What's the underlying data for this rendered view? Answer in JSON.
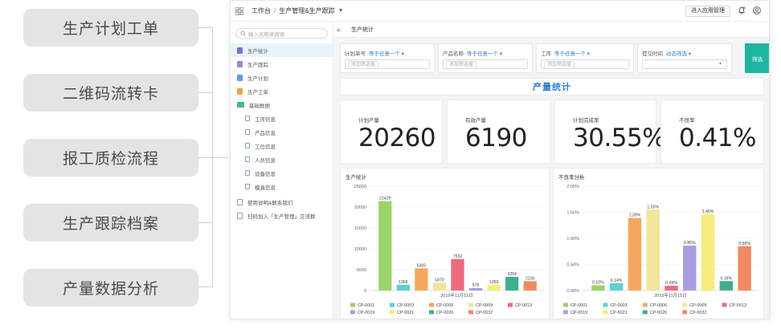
{
  "features": [
    "生产计划工单",
    "二维码流转卡",
    "报工质检流程",
    "生产跟踪档案",
    "产量数据分析"
  ],
  "topbar": {
    "workspace": "工作台",
    "app_name": "生产管理&生产跟踪",
    "enter_button": "进入应用管理"
  },
  "sidebar": {
    "search_placeholder": "输入名称来搜索",
    "items": [
      {
        "label": "生产统计",
        "color": "#7b6cd6",
        "active": true
      },
      {
        "label": "生产跟踪",
        "color": "#9a8ad9",
        "active": false
      },
      {
        "label": "生产计划",
        "color": "#5aa0e0",
        "active": false
      },
      {
        "label": "生产工单",
        "color": "#f0a33c",
        "active": false
      },
      {
        "label": "基础数据",
        "color": "#46b886",
        "active": false
      }
    ],
    "sub_items": [
      "工序信息",
      "产品信息",
      "工位信息",
      "人员信息",
      "设备信息",
      "模具信息"
    ],
    "bottom_items": [
      "使用说明&联系我们",
      "扫码加入「生产管理」交流群"
    ]
  },
  "tab": {
    "label": "生产统计"
  },
  "filters": [
    {
      "label": "计划单号",
      "mode": "等于任意一个",
      "placeholder": "添加筛选值"
    },
    {
      "label": "产品名称",
      "mode": "等于任意一个",
      "placeholder": "添加筛选值"
    },
    {
      "label": "工序",
      "mode": "等于任意一个",
      "placeholder": "添加筛选值"
    },
    {
      "label": "提交时间",
      "mode": "动态筛选",
      "placeholder": ""
    }
  ],
  "filter_button": "筛选",
  "report_title": "产量统计",
  "kpis": [
    {
      "label": "计划产量",
      "value": "20260"
    },
    {
      "label": "有效产量",
      "value": "6190"
    },
    {
      "label": "计划完成率",
      "value": "30.55%"
    },
    {
      "label": "不良率",
      "value": "0.41%"
    }
  ],
  "chart_data": [
    {
      "type": "bar",
      "title": "生产统计",
      "xlabel": "2019年11月15日",
      "ylim": [
        0,
        25000
      ],
      "yticks": [
        "0",
        "5000",
        "10000",
        "15000",
        "20000",
        "25000"
      ],
      "series": [
        {
          "name": "CP-0001",
          "color": "#9bd36b",
          "value": 21429,
          "label": "21429"
        },
        {
          "name": "CP-0003",
          "color": "#5ecfd6",
          "value": 1366,
          "label": "1366"
        },
        {
          "name": "CP-0006",
          "color": "#f2a95e",
          "value": 5305,
          "label": "5305"
        },
        {
          "name": "CP-0009",
          "color": "#f2e49a",
          "value": 1870,
          "label": "1870"
        },
        {
          "name": "CP-0013",
          "color": "#ee6a80",
          "value": 7532,
          "label": "7532"
        },
        {
          "name": "CP-0019",
          "color": "#a99ee0",
          "value": 575,
          "label": "575"
        },
        {
          "name": "CP-0021",
          "color": "#f7ec7a",
          "value": 1360,
          "label": "1360"
        },
        {
          "name": "CP-0026",
          "color": "#3fae8e",
          "value": 3264,
          "label": "3264"
        },
        {
          "name": "CP-0032",
          "color": "#f08a63",
          "value": 2230,
          "label": "2230"
        }
      ]
    },
    {
      "type": "bar",
      "title": "不良率分析",
      "xlabel": "2019年11月15日",
      "ylim": [
        0,
        2
      ],
      "yticks": [
        "0.00%",
        "0.50%",
        "1.00%",
        "1.50%",
        "2.00%"
      ],
      "series": [
        {
          "name": "CP-0001",
          "color": "#9bd36b",
          "value": 0.1,
          "label": "0.10%"
        },
        {
          "name": "CP-0003",
          "color": "#5ecfd6",
          "value": 0.14,
          "label": "0.14%"
        },
        {
          "name": "CP-0006",
          "color": "#f2a95e",
          "value": 1.39,
          "label": "1.39%"
        },
        {
          "name": "CP-0009",
          "color": "#f2e49a",
          "value": 1.55,
          "label": "1.55%"
        },
        {
          "name": "CP-0013",
          "color": "#ee6a80",
          "value": 0.09,
          "label": "0.09%"
        },
        {
          "name": "CP-0019",
          "color": "#a99ee0",
          "value": 0.86,
          "label": "0.86%"
        },
        {
          "name": "CP-0021",
          "color": "#f7ec7a",
          "value": 1.46,
          "label": "1.46%"
        },
        {
          "name": "CP-0026",
          "color": "#3fae8e",
          "value": 0.18,
          "label": "0.18%"
        },
        {
          "name": "CP-0032",
          "color": "#f08a63",
          "value": 0.85,
          "label": "0.85%"
        }
      ]
    }
  ]
}
